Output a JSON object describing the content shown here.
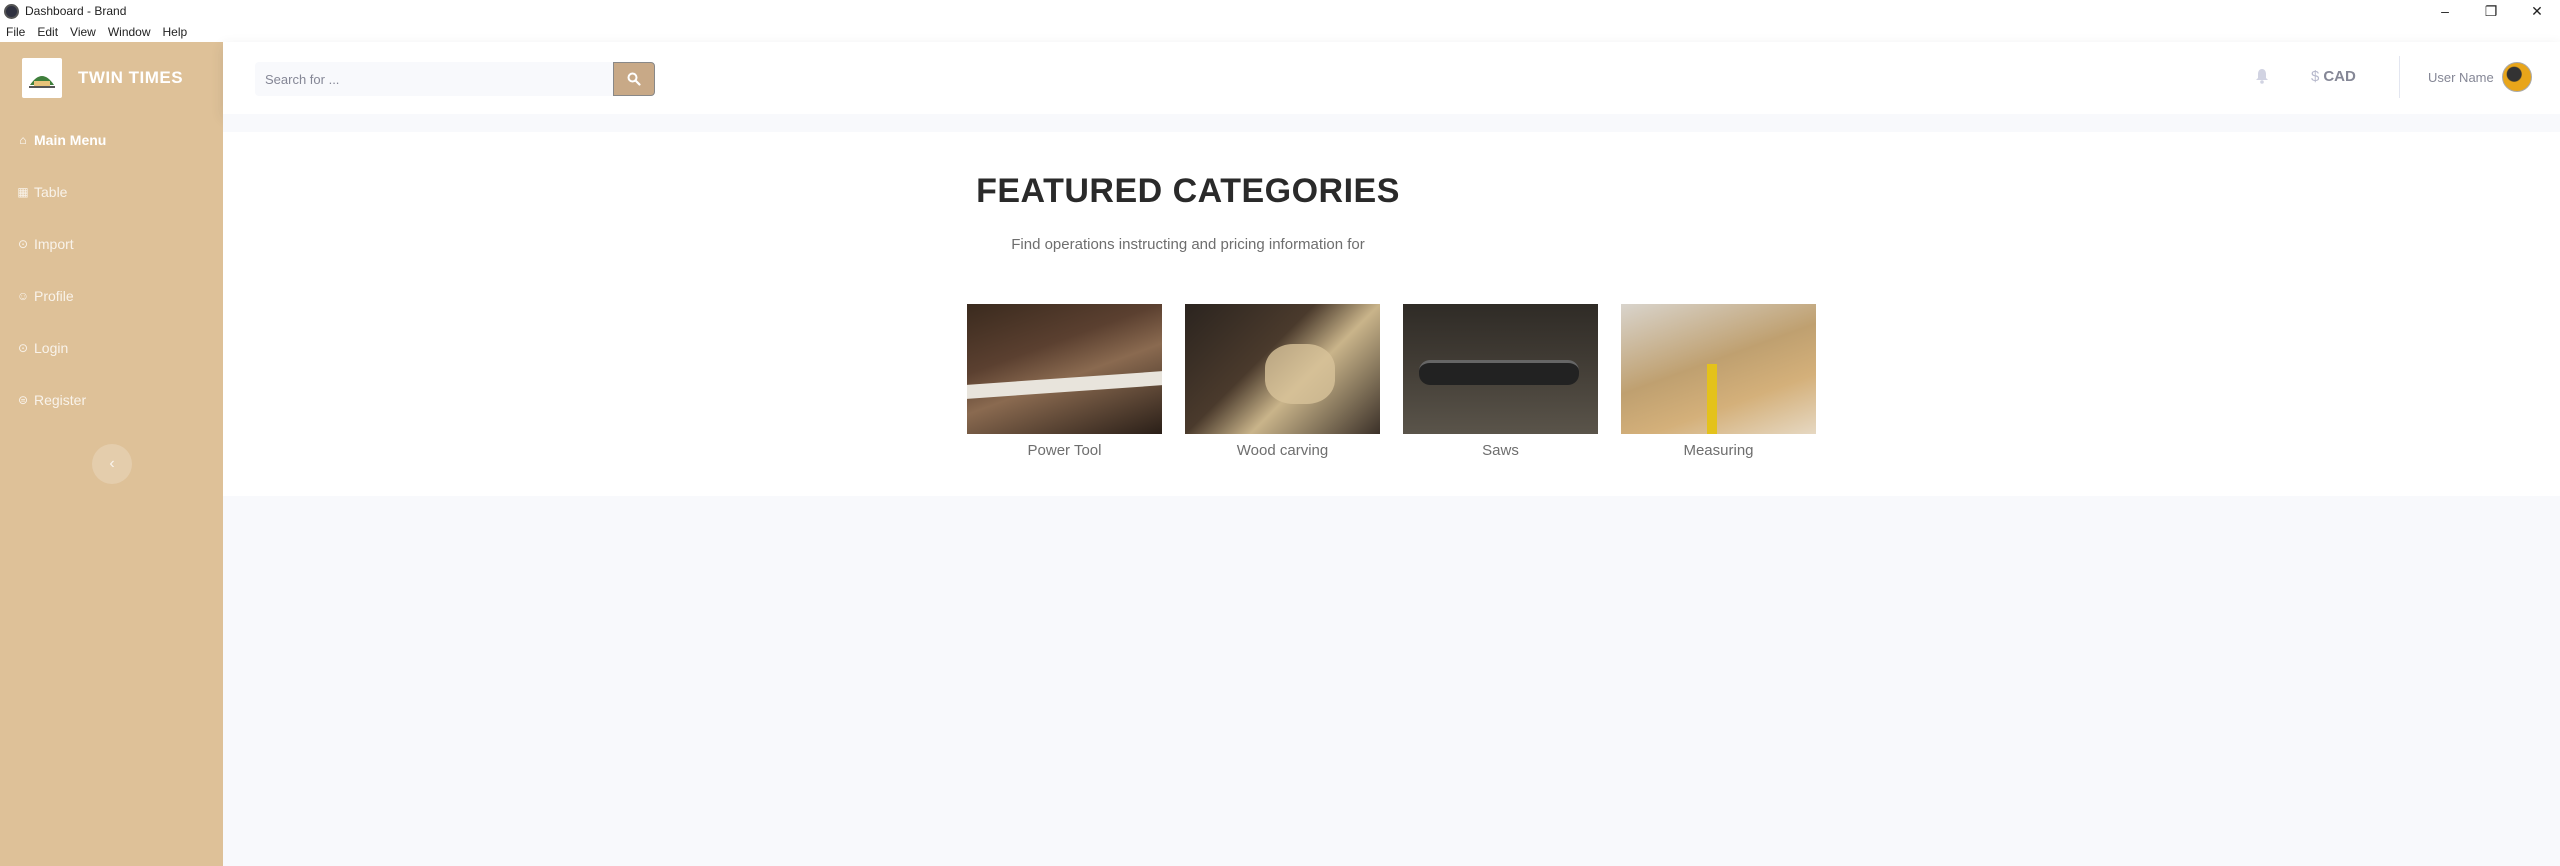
{
  "window": {
    "title": "Dashboard - Brand",
    "controls": {
      "minimize": "–",
      "restore": "❐",
      "close": "✕"
    }
  },
  "menubar": [
    "File",
    "Edit",
    "View",
    "Window",
    "Help"
  ],
  "sidebar": {
    "brand_name": "TWIN TIMES",
    "items": [
      {
        "label": "Main Menu",
        "icon": "home-icon",
        "active": true
      },
      {
        "label": "Table",
        "icon": "table-icon"
      },
      {
        "label": "Import",
        "icon": "import-icon"
      },
      {
        "label": "Profile",
        "icon": "user-icon"
      },
      {
        "label": "Login",
        "icon": "login-icon"
      },
      {
        "label": "Register",
        "icon": "register-icon"
      }
    ],
    "collapse_label": "‹"
  },
  "topbar": {
    "search_placeholder": "Search for ...",
    "currency_symbol": "$",
    "currency": "CAD",
    "user_name": "User Name"
  },
  "featured": {
    "title": "FEATURED CATEGORIES",
    "subtitle": "Find operations instructing and pricing information for",
    "categories": [
      {
        "label": "Power Tool"
      },
      {
        "label": "Wood carving"
      },
      {
        "label": "Saws"
      },
      {
        "label": "Measuring"
      }
    ]
  },
  "colors": {
    "sidebar_bg": "#dec198",
    "search_button": "#c8a987",
    "page_bg": "#f8f9fc"
  }
}
